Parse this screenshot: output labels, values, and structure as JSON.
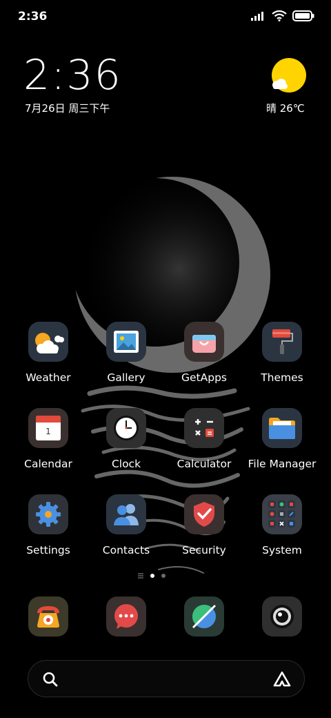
{
  "status_bar": {
    "time": "2:36"
  },
  "clock_widget": {
    "time": "2:36",
    "date": "7月26日 周三下午"
  },
  "weather_widget": {
    "text": "晴 26℃"
  },
  "apps": [
    {
      "label": "Weather",
      "icon": "weather-icon"
    },
    {
      "label": "Gallery",
      "icon": "gallery-icon"
    },
    {
      "label": "GetApps",
      "icon": "getapps-icon"
    },
    {
      "label": "Themes",
      "icon": "themes-icon"
    },
    {
      "label": "Calendar",
      "icon": "calendar-icon",
      "day": "1"
    },
    {
      "label": "Clock",
      "icon": "clock-icon"
    },
    {
      "label": "Calculator",
      "icon": "calculator-icon"
    },
    {
      "label": "File Manager",
      "icon": "file-manager-icon"
    },
    {
      "label": "Settings",
      "icon": "settings-icon"
    },
    {
      "label": "Contacts",
      "icon": "contacts-icon"
    },
    {
      "label": "Security",
      "icon": "security-icon"
    },
    {
      "label": "System",
      "icon": "system-folder-icon"
    }
  ],
  "dock": [
    {
      "icon": "phone-icon"
    },
    {
      "icon": "messages-icon"
    },
    {
      "icon": "browser-icon"
    },
    {
      "icon": "camera-icon"
    }
  ],
  "pages": {
    "count": 2,
    "active": 1
  },
  "colors": {
    "accent_yellow": "#ffd400",
    "icon_bg": "#2b3542"
  }
}
